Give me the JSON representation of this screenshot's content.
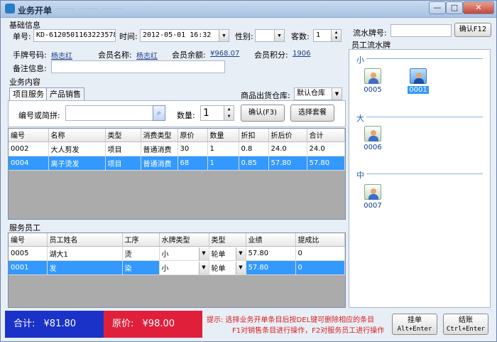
{
  "window": {
    "title": "业务开单",
    "title_ghost": "——— ——— ———"
  },
  "basic": {
    "section": "基础信息",
    "order_no_label": "单号:",
    "order_no": "KD-6120501163223578",
    "time_label": "时间:",
    "time": "2012-05-01 16:32",
    "gender_label": "性别:",
    "gender": "",
    "guests_label": "客数:",
    "guests": "1",
    "card_label": "手牌号码:",
    "card": "杨志红",
    "member_name_label": "会员名称:",
    "member_name": "杨志红",
    "balance_label": "会员余额:",
    "balance": "¥968.07",
    "points_label": "会员积分:",
    "points": "1906",
    "remark_label": "备注信息:",
    "remark": ""
  },
  "business": {
    "section": "业务内容",
    "tabs": [
      {
        "label": "项目服务"
      },
      {
        "label": "产品销售"
      }
    ],
    "warehouse_label": "商品出货仓库:",
    "warehouse": "默认仓库",
    "code_label": "编号或简拼:",
    "code": "",
    "qty_label": "数量:",
    "qty": "1",
    "confirm_btn": "确认(F3)",
    "package_btn": "选择套餐",
    "columns": [
      "编号",
      "名称",
      "类型",
      "消费类型",
      "原价",
      "数量",
      "折扣",
      "折后价",
      "合计"
    ],
    "rows": [
      [
        "0002",
        "大人剪发",
        "项目",
        "普通消费",
        "30",
        "1",
        "0.8",
        "24.0",
        "24.0"
      ],
      [
        "0004",
        "离子烫发",
        "项目",
        "普通消费",
        "68",
        "1",
        "0.85",
        "57.80",
        "57.80"
      ]
    ]
  },
  "staff": {
    "section": "服务员工",
    "columns": [
      "编号",
      "员工姓名",
      "工序",
      "水牌类型",
      "类型",
      "业绩",
      "提成比"
    ],
    "rows": [
      [
        "0005",
        "湖大1",
        "烫",
        "小",
        "轮单",
        "57.80",
        "0"
      ],
      [
        "0001",
        "发",
        "染",
        "小",
        "轮单",
        "57.80",
        "0"
      ]
    ]
  },
  "right": {
    "flow_label": "流水牌号:",
    "flow_value": "",
    "confirm_btn": "确认F12",
    "title": "员工流水牌",
    "groups": [
      {
        "name": "小",
        "tiles": [
          "0005",
          "0001"
        ]
      },
      {
        "name": "大",
        "tiles": [
          "0006"
        ]
      },
      {
        "name": "中",
        "tiles": [
          "0007"
        ]
      }
    ]
  },
  "footer": {
    "total_label": "合计:",
    "total": "¥81.80",
    "orig_label": "原价:",
    "orig": "¥98.00",
    "hint1": "提示: 选择业务开单条目后按DEL键可删除相应的条目",
    "hint2": "F1对销售条目进行操作，F2对服务员工进行操作",
    "hang_btn": "挂单",
    "hang_key": "Alt+Enter",
    "checkout_btn": "结账",
    "checkout_key": "Ctrl+Enter"
  },
  "colors": {
    "total_bg": "#1a32c8",
    "orig_bg": "#e0203a",
    "selection": "#3399ff"
  }
}
